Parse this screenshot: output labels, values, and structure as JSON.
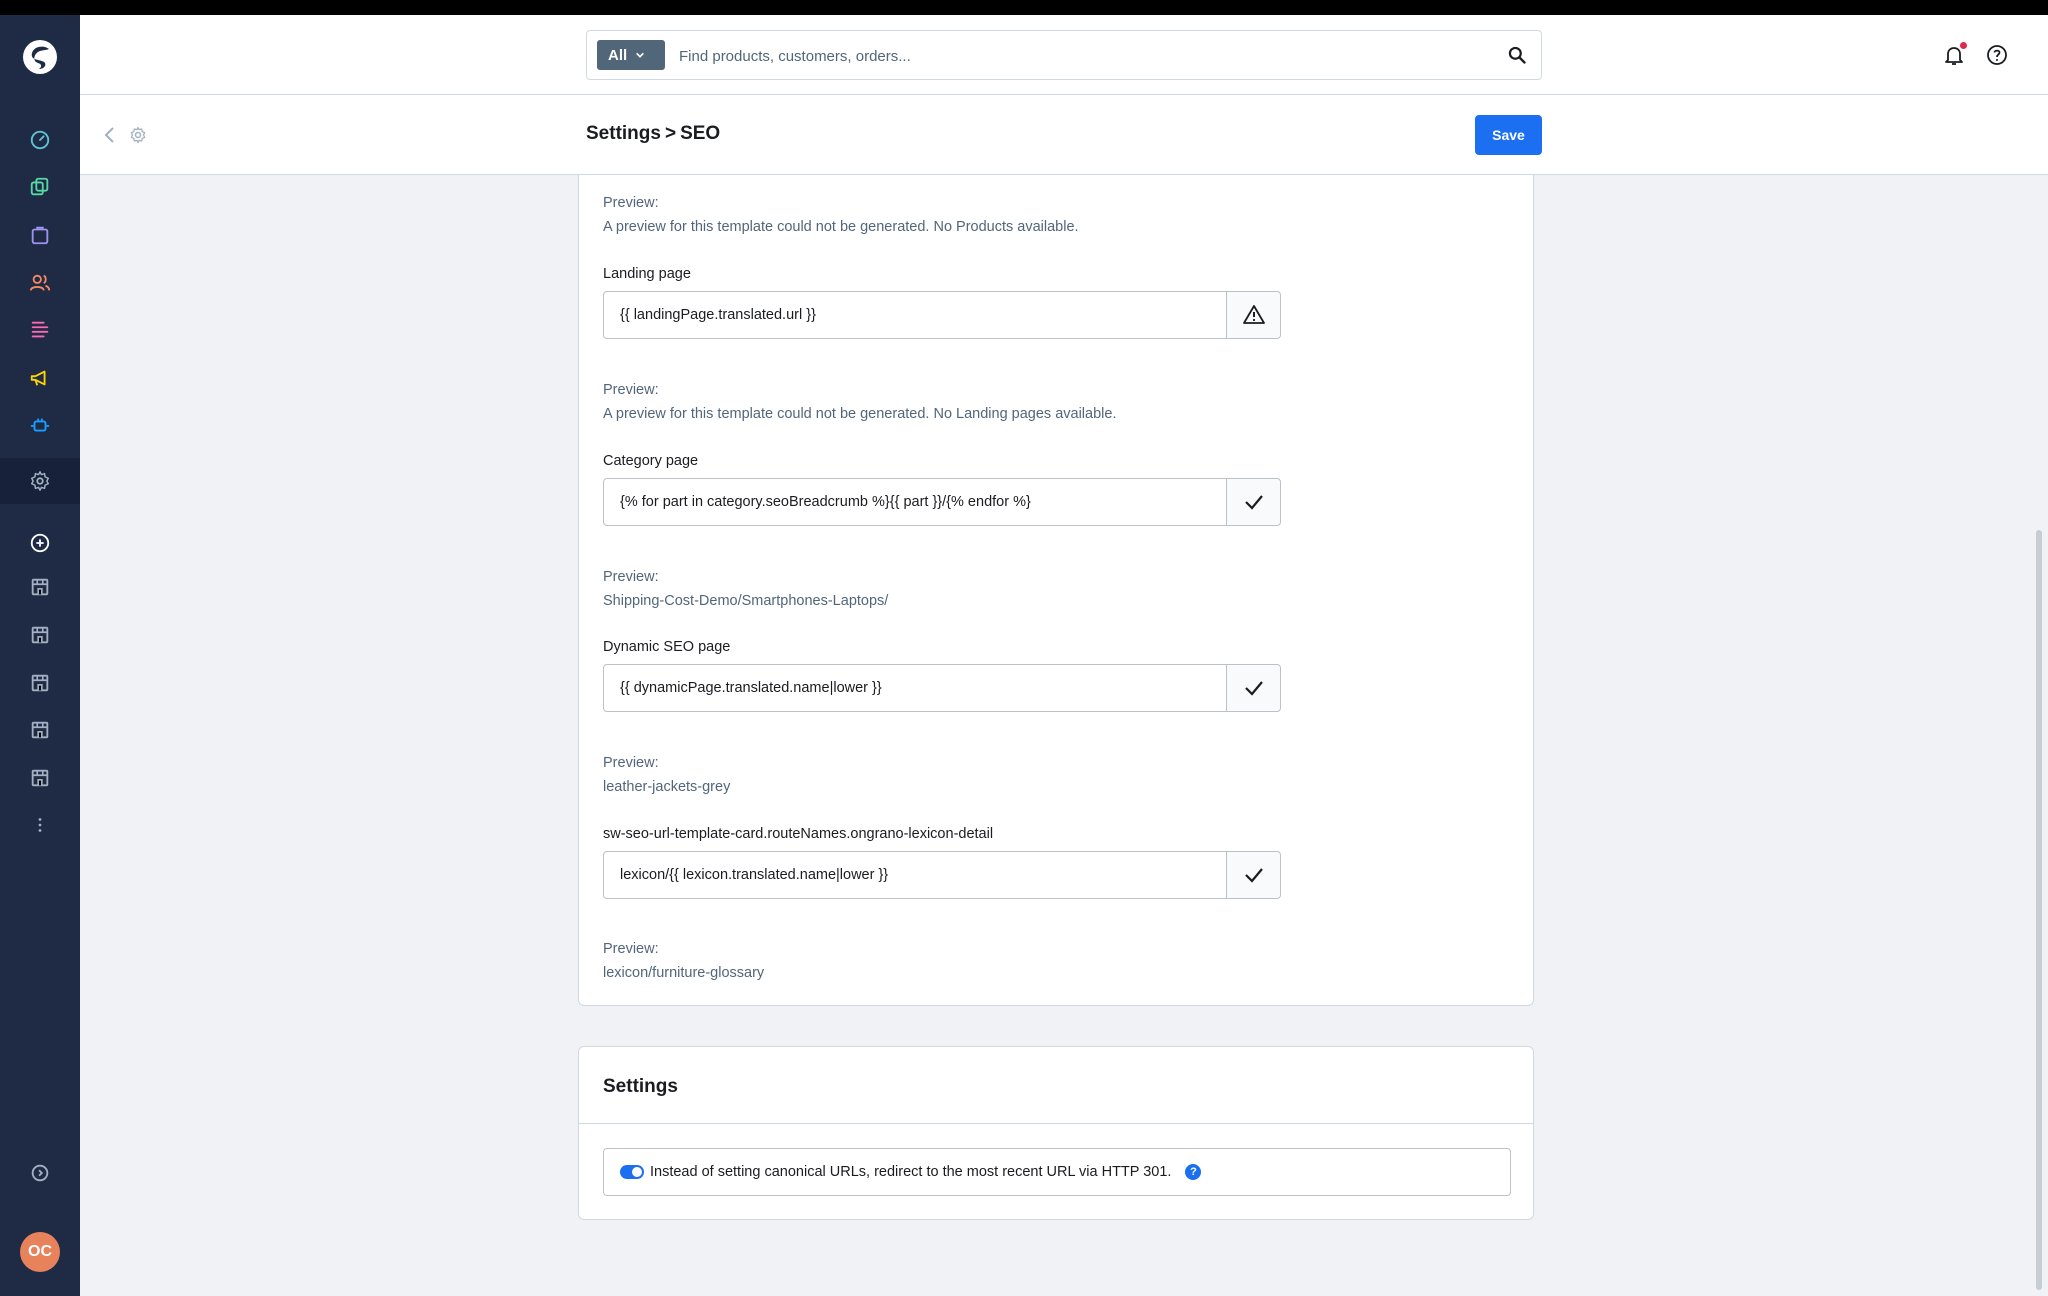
{
  "header": {
    "search_type": "All",
    "search_placeholder": "Find products, customers, orders..."
  },
  "subheader": {
    "breadcrumb_parent": "Settings",
    "breadcrumb_separator": ">",
    "breadcrumb_current": "SEO",
    "save_label": "Save"
  },
  "templates": {
    "top_preview_label": "Preview:",
    "top_preview_text": "A preview for this template could not be generated. No Products available.",
    "items": [
      {
        "label": "Landing page",
        "value": "{{ landingPage.translated.url }}",
        "status_icon": "warning-icon",
        "preview_label": "Preview:",
        "preview_text": "A preview for this template could not be generated. No Landing pages available."
      },
      {
        "label": "Category page",
        "value": "{% for part in category.seoBreadcrumb %}{{ part }}/{% endfor %}",
        "status_icon": "checkmark-icon",
        "preview_label": "Preview:",
        "preview_text": "Shipping-Cost-Demo/Smartphones-Laptops/"
      },
      {
        "label": "Dynamic SEO page",
        "value": "{{ dynamicPage.translated.name|lower }}",
        "status_icon": "checkmark-icon",
        "preview_label": "Preview:",
        "preview_text": "leather-jackets-grey"
      },
      {
        "label": "sw-seo-url-template-card.routeNames.ongrano-lexicon-detail",
        "value": "lexicon/{{ lexicon.translated.name|lower }}",
        "status_icon": "checkmark-icon",
        "preview_label": "Preview:",
        "preview_text": "lexicon/furniture-glossary"
      }
    ]
  },
  "settings_card": {
    "title": "Settings",
    "redirect_label": "Instead of setting canonical URLs, redirect to the most recent URL via HTTP 301.",
    "redirect_enabled": true,
    "help_glyph": "?"
  },
  "user": {
    "initials": "OC"
  },
  "colors": {
    "sidebar": "#1f2b45",
    "primary": "#1c6ff0",
    "avatar": "#e8825b"
  }
}
